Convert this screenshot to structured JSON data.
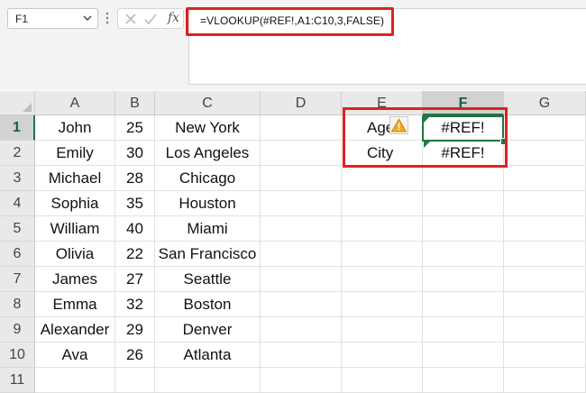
{
  "name_box": {
    "value": "F1"
  },
  "formula_bar": {
    "fx_label": "fx",
    "formula": "=VLOOKUP(#REF!,A1:C10,3,FALSE)"
  },
  "columns": [
    "A",
    "B",
    "C",
    "D",
    "E",
    "F",
    "G"
  ],
  "selected_column": "F",
  "rows": [
    {
      "num": "1",
      "A": "John",
      "B": "25",
      "C": "New York",
      "E": "Age",
      "F": "#REF!"
    },
    {
      "num": "2",
      "A": "Emily",
      "B": "30",
      "C": "Los Angeles",
      "E": "City",
      "F": "#REF!"
    },
    {
      "num": "3",
      "A": "Michael",
      "B": "28",
      "C": "Chicago"
    },
    {
      "num": "4",
      "A": "Sophia",
      "B": "35",
      "C": "Houston"
    },
    {
      "num": "5",
      "A": "William",
      "B": "40",
      "C": "Miami"
    },
    {
      "num": "6",
      "A": "Olivia",
      "B": "22",
      "C": "San Francisco"
    },
    {
      "num": "7",
      "A": "James",
      "B": "27",
      "C": "Seattle"
    },
    {
      "num": "8",
      "A": "Emma",
      "B": "32",
      "C": "Boston"
    },
    {
      "num": "9",
      "A": "Alexander",
      "B": "29",
      "C": "Denver"
    },
    {
      "num": "10",
      "A": "Ava",
      "B": "26",
      "C": "Atlanta"
    },
    {
      "num": "11"
    }
  ],
  "colors": {
    "accent": "#217346",
    "highlight": "#e02020",
    "warning": "#f5a623"
  }
}
